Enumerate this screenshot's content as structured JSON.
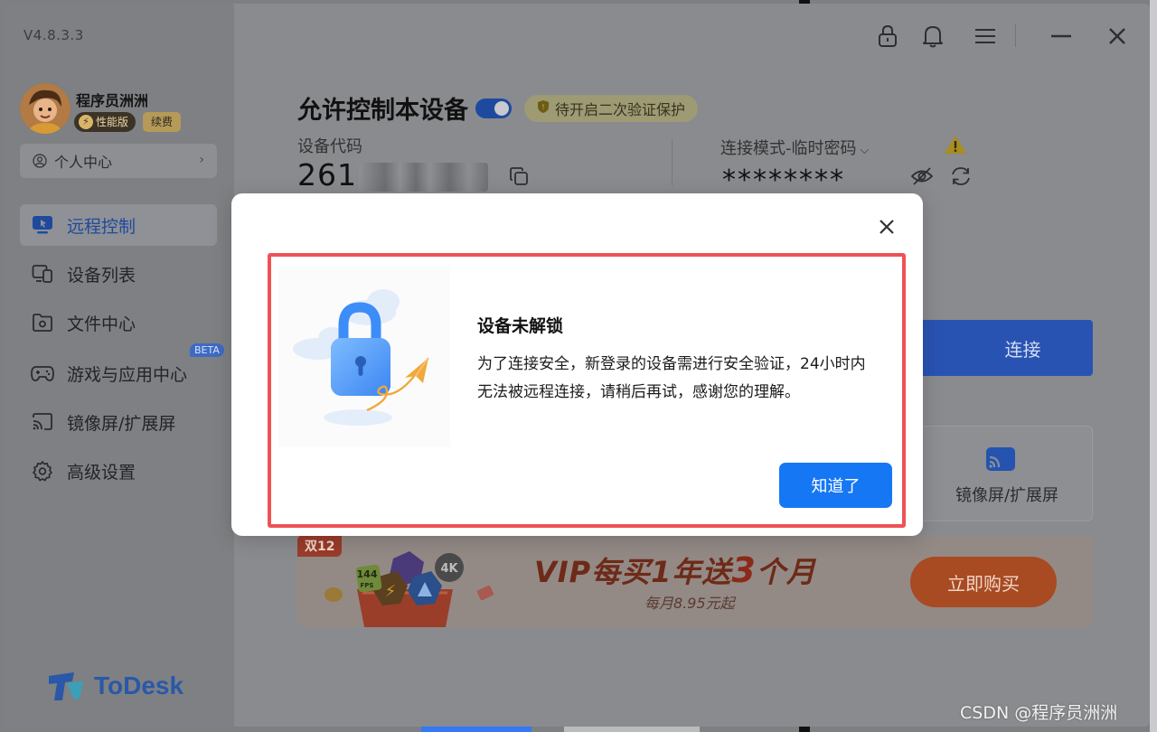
{
  "app": {
    "version": "V4.8.3.3",
    "brand_name": "ToDesk"
  },
  "user": {
    "name": "程序员洲洲",
    "perf_badge": "性能版",
    "renew_badge": "续费",
    "personal_center": "个人中心"
  },
  "sidebar": {
    "items": [
      {
        "label": "远程控制",
        "icon": "monitor-icon",
        "active": true
      },
      {
        "label": "设备列表",
        "icon": "devices-icon"
      },
      {
        "label": "文件中心",
        "icon": "folder-gear-icon"
      },
      {
        "label": "游戏与应用中心",
        "icon": "gamepad-icon",
        "badge": "BETA"
      },
      {
        "label": "镜像屏/扩展屏",
        "icon": "cast-icon"
      },
      {
        "label": "高级设置",
        "icon": "gear-icon"
      }
    ]
  },
  "main": {
    "title": "允许控制本设备",
    "allow_control_enabled": true,
    "verify_pill": "待开启二次验证保护",
    "device_code_label": "设备代码",
    "device_code_prefix": "261",
    "conn_mode_label": "连接模式-临时密码",
    "password_mask": "********",
    "connect_button": "连接",
    "mirror_card_label": "镜像屏/扩展屏"
  },
  "banner": {
    "tag": "双12",
    "title_part1": "VIP每买1年送",
    "title_big": "3",
    "title_part2": "个月",
    "subtitle": "每月8.95元起",
    "buy_button": "立即购买",
    "art_labels": {
      "fps": "144",
      "fps_unit": "FPS",
      "res": "4K"
    }
  },
  "dialog": {
    "title": "设备未解锁",
    "body": "为了连接安全，新登录的设备需进行安全验证，24小时内无法被远程连接，请稍后再试，感谢您的理解。",
    "ok_button": "知道了"
  },
  "colors": {
    "accent_blue": "#1677f5",
    "highlight_red": "#ee5256",
    "overlay_gray": "#838487"
  },
  "watermark": "CSDN @程序员洲洲"
}
